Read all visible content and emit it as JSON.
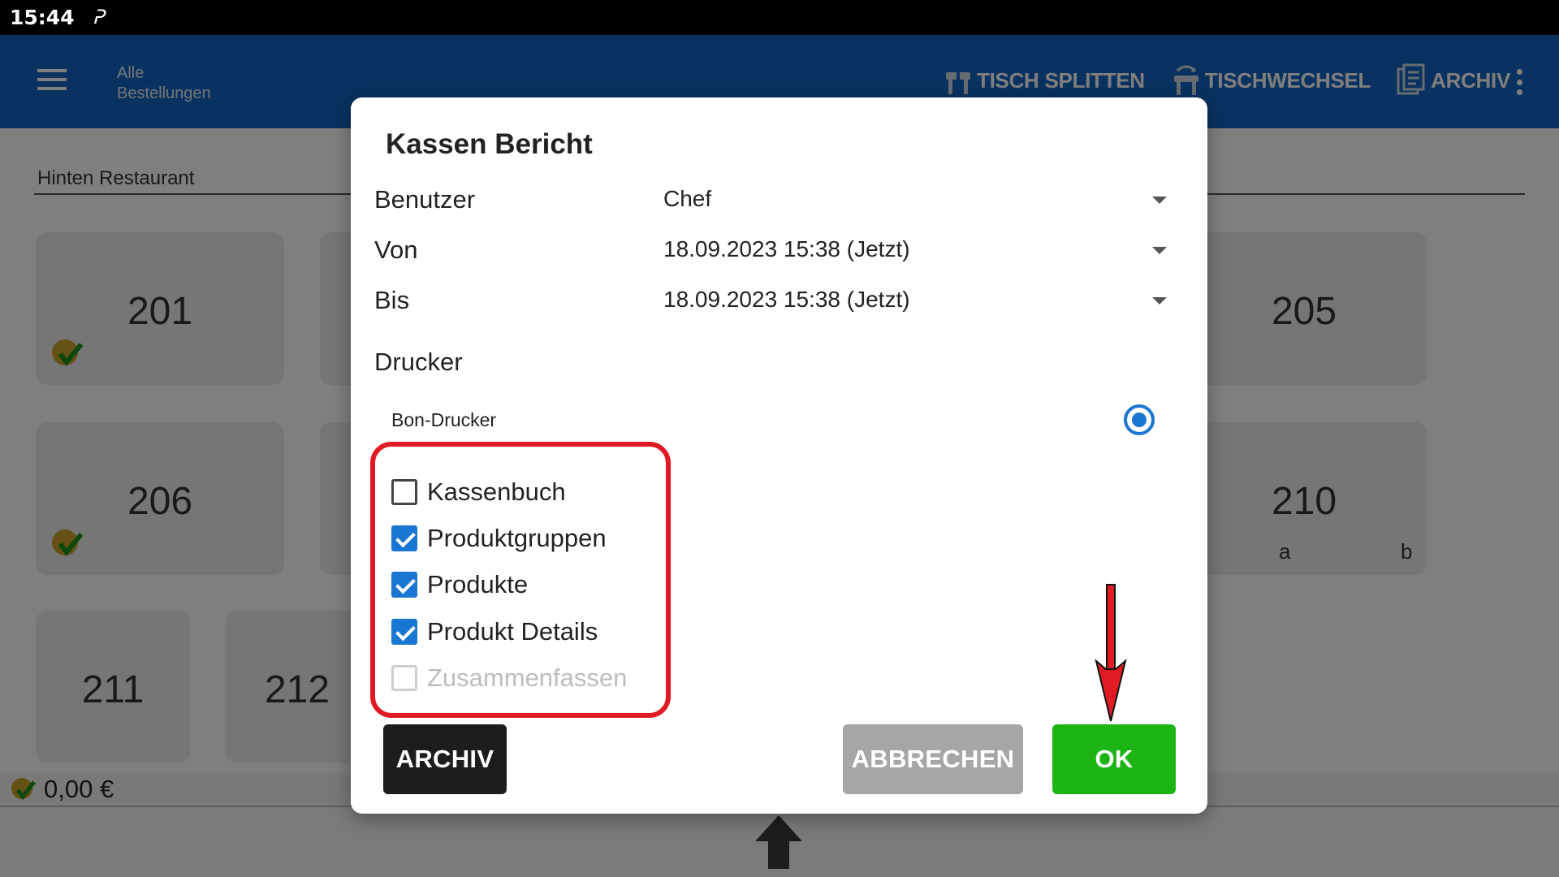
{
  "status_bar": {
    "time": "15:44",
    "notification_icon": "p-icon"
  },
  "app_bar": {
    "title_line1": "Alle",
    "title_line2": "Bestellungen",
    "actions": [
      {
        "label": "TISCH SPLITTEN",
        "icon": "split-table-icon"
      },
      {
        "label": "TISCHWECHSEL",
        "icon": "change-table-icon"
      },
      {
        "label": "ARCHIV",
        "icon": "archive-icon"
      }
    ]
  },
  "area": {
    "name": "Hinten Restaurant"
  },
  "tables": [
    {
      "number": "201"
    },
    {
      "number": "205"
    },
    {
      "number": "206"
    },
    {
      "number": "210",
      "splits": [
        "a",
        "b"
      ]
    },
    {
      "number": "211"
    },
    {
      "number": "212"
    }
  ],
  "footer": {
    "total": "0,00 €"
  },
  "dialog": {
    "title": "Kassen Bericht",
    "fields": [
      {
        "label": "Benutzer",
        "value": "Chef"
      },
      {
        "label": "Von",
        "value": "18.09.2023 15:38 (Jetzt)"
      },
      {
        "label": "Bis",
        "value": "18.09.2023 15:38 (Jetzt)"
      }
    ],
    "printer_section": "Drucker",
    "printer": {
      "name": "Bon-Drucker",
      "selected": true
    },
    "options": [
      {
        "label": "Kassenbuch",
        "checked": false,
        "enabled": true
      },
      {
        "label": "Produktgruppen",
        "checked": true,
        "enabled": true
      },
      {
        "label": "Produkte",
        "checked": true,
        "enabled": true
      },
      {
        "label": "Produkt Details",
        "checked": true,
        "enabled": true
      },
      {
        "label": "Zusammenfassen",
        "checked": false,
        "enabled": false
      }
    ],
    "buttons": {
      "archive": "ARCHIV",
      "cancel": "ABBRECHEN",
      "ok": "OK"
    }
  },
  "colors": {
    "app_bar": "#1565c0",
    "accent": "#1976d2",
    "ok_button": "#1db516",
    "cancel_button": "#a6a6a6",
    "highlight": "#e01b23"
  }
}
